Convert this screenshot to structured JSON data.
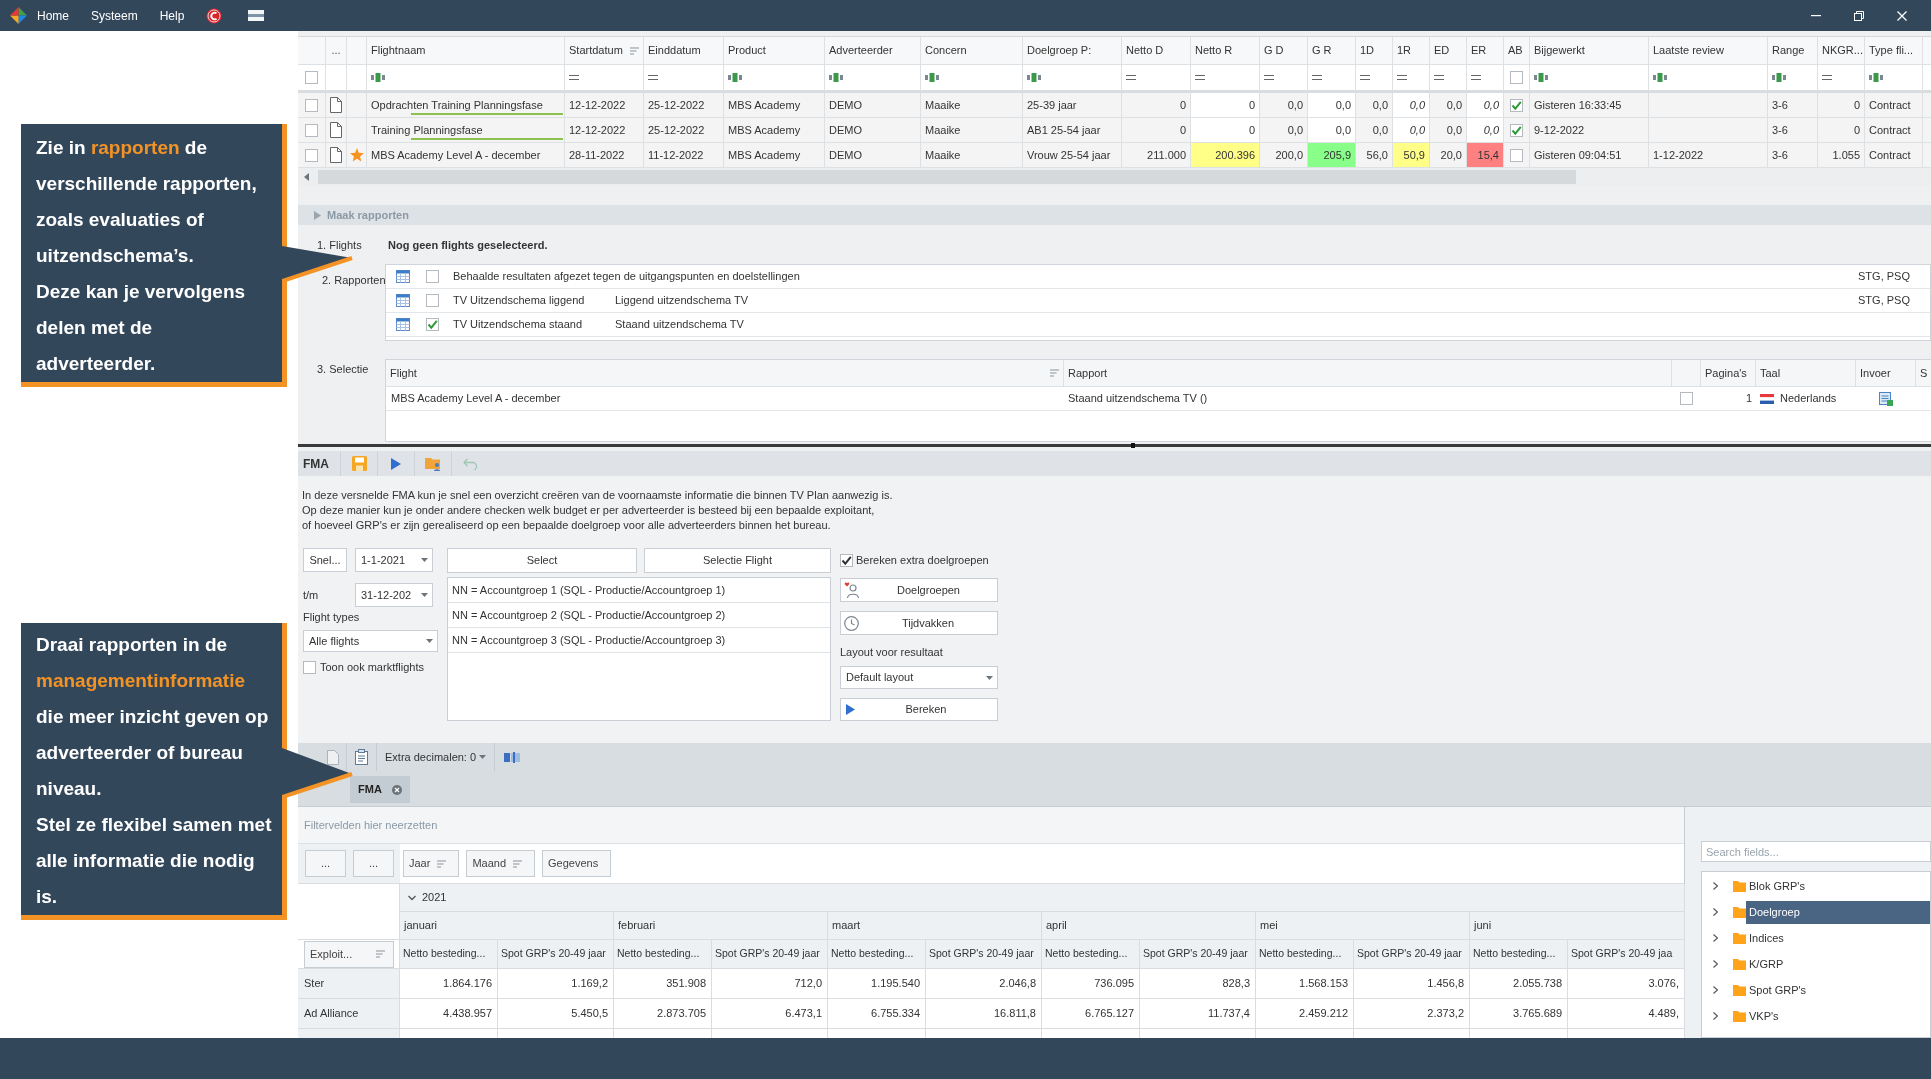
{
  "menu": [
    "Home",
    "Systeem",
    "Help"
  ],
  "callouts": [
    {
      "paragraphs": [
        "Zie in **rapporten** de verschillende rapporten, zoals evaluaties of uitzendschema’s.",
        "Deze kan je vervolgens delen met de adverteerder."
      ]
    },
    {
      "paragraphs": [
        "Draai rapporten in de **managementinformatie** die meer inzicht geven op adverteerder of bureau niveau.",
        "Stel ze flexibel samen met alle informatie die nodig is."
      ]
    }
  ],
  "flights_grid": {
    "menu_header": "...",
    "select_all_checked": false,
    "columns": [
      {
        "label": "Flightnaam",
        "kind": "text",
        "sorted": false
      },
      {
        "label": "Startdatum",
        "kind": "date",
        "sorted": true
      },
      {
        "label": "Einddatum",
        "kind": "date",
        "sorted": false
      },
      {
        "label": "Product",
        "kind": "text",
        "sorted": false
      },
      {
        "label": "Adverteerder",
        "kind": "text",
        "sorted": false
      },
      {
        "label": "Concern",
        "kind": "text",
        "sorted": false
      },
      {
        "label": "Doelgroep P:",
        "kind": "text",
        "sorted": false
      },
      {
        "label": "Netto D",
        "kind": "number",
        "sorted": false
      },
      {
        "label": "Netto R",
        "kind": "entry",
        "sorted": false
      },
      {
        "label": "G D",
        "kind": "number",
        "sorted": false
      },
      {
        "label": "G R",
        "kind": "entry",
        "sorted": false
      },
      {
        "label": "1D",
        "kind": "number",
        "sorted": false
      },
      {
        "label": "1R",
        "kind": "entry",
        "sorted": false
      },
      {
        "label": "ED",
        "kind": "number",
        "sorted": false
      },
      {
        "label": "ER",
        "kind": "entry",
        "sorted": false
      },
      {
        "label": "AB",
        "kind": "check",
        "sorted": false,
        "filter_checked": false
      },
      {
        "label": "Bijgewerkt",
        "kind": "text",
        "sorted": false
      },
      {
        "label": "Laatste review",
        "kind": "text",
        "sorted": false
      },
      {
        "label": "Range",
        "kind": "text",
        "sorted": false
      },
      {
        "label": "NKGR...",
        "kind": "number",
        "sorted": false
      },
      {
        "label": "Type fli...",
        "kind": "text",
        "sorted": false
      }
    ],
    "rows": [
      {
        "checked": false,
        "starred": false,
        "underlined": true,
        "cells": [
          "Opdrachten Training Planningsfase",
          "12-12-2022",
          "25-12-2022",
          "MBS Academy",
          "DEMO",
          "Maaike",
          "25-39 jaar",
          "0",
          "0",
          "0,0",
          "0,0",
          "0,0",
          {
            "text": "0,0",
            "estimated": true
          },
          "0,0",
          {
            "text": "0,0",
            "estimated": true
          },
          {
            "checked": true
          },
          "Gisteren 16:33:45",
          null,
          "3-6",
          "0",
          "Contract"
        ]
      },
      {
        "checked": false,
        "starred": false,
        "underlined": true,
        "cells": [
          "Training Planningsfase",
          "12-12-2022",
          "25-12-2022",
          "MBS Academy",
          "DEMO",
          "Maaike",
          "AB1 25-54 jaar",
          "0",
          "0",
          "0,0",
          "0,0",
          "0,0",
          {
            "text": "0,0",
            "estimated": true
          },
          "0,0",
          {
            "text": "0,0",
            "estimated": true
          },
          {
            "checked": true
          },
          "9-12-2022",
          null,
          "3-6",
          "0",
          "Contract"
        ]
      },
      {
        "checked": false,
        "starred": true,
        "underlined": false,
        "cells": [
          "MBS Academy Level A - december",
          "28-11-2022",
          "11-12-2022",
          "MBS Academy",
          "DEMO",
          "Maaike",
          "Vrouw 25-54 jaar",
          "211.000",
          {
            "text": "200.396",
            "color": "#ffff88"
          },
          "200,0",
          {
            "text": "205,9",
            "color": "#88ff88"
          },
          "56,0",
          {
            "text": "50,9",
            "color": "#ffff88",
            "estimated": false
          },
          "20,0",
          {
            "text": "15,4",
            "color": "#ff8080",
            "estimated": false
          },
          {
            "checked": false
          },
          "Gisteren 09:04:51",
          "1-12-2022",
          "3-6",
          "1.055",
          "Contract"
        ]
      }
    ]
  },
  "reports_panel": {
    "title": "Maak rapporten",
    "step_flights": "1. Flights",
    "no_flights": "Nog geen flights geselecteerd.",
    "step_reports": "2. Rapporten",
    "reports": [
      {
        "checked": false,
        "name": "Behaalde resultaten afgezet tegen de uitgangspunten en doelstellingen",
        "codes": "STG, PSQ"
      },
      {
        "checked": false,
        "name": "TV Uitzendschema liggend",
        "description": "Liggend uitzendschema TV",
        "codes": "STG, PSQ"
      },
      {
        "checked": true,
        "name": "TV Uitzendschema staand",
        "description": "Staand uitzendschema TV"
      }
    ],
    "step_selection": "3. Selectie",
    "selection": {
      "columns": [
        {
          "label": "Flight",
          "sorted": true
        },
        {
          "label": "Rapport",
          "sorted": false
        },
        {
          "label": "Pagina's",
          "sorted": false
        },
        {
          "label": "Taal",
          "sorted": false
        },
        {
          "label": "Invoer",
          "sorted": false
        },
        {
          "label": "S",
          "sorted": false
        }
      ],
      "rows": [
        {
          "flight": "MBS Academy Level A - december",
          "report": "Staand uitzendschema TV ()",
          "checked": false,
          "pages": "1",
          "language": "Nederlands"
        }
      ]
    }
  },
  "fma": {
    "title": "FMA",
    "undo_disabled": true,
    "description": [
      "In deze versnelde FMA kun je snel een overzicht creëren van de voornaamste informatie die binnen TV Plan aanwezig is.",
      "Op deze manier kun je onder andere checken welk budget er per adverteerder is besteed bij een bepaalde exploitant,",
      "of hoeveel GRP's er zijn gerealiseerd op een bepaalde doelgroep voor alle adverteerders binnen het bureau."
    ],
    "quick_button": "Snel...",
    "date_from": "1-1-2021",
    "to_label": "t/m",
    "date_to": "31-12-202",
    "flight_types_label": "Flight types",
    "flight_type": "Alle flights",
    "market_flights": {
      "label": "Toon ook marktflights",
      "checked": false
    },
    "select_button": "Select",
    "selection_flight_button": "Selectie Flight",
    "account_groups": [
      "NN = Accountgroep 1 (SQL - Productie/Accountgroep 1)",
      "NN = Accountgroep 2 (SQL - Productie/Accountgroep 2)",
      "NN = Accountgroep 3 (SQL - Productie/Accountgroep 3)"
    ],
    "extra_targets": {
      "label": "Bereken extra doelgroepen",
      "checked": true
    },
    "targets_button": "Doelgroepen",
    "periods_button": "Tijdvakken",
    "layout_label": "Layout voor resultaat",
    "layout": "Default layout",
    "compute_button": "Bereken"
  },
  "pivot_toolbar": {
    "export_disabled": true,
    "decimals_label": "Extra decimalen: 0"
  },
  "tabs": [
    {
      "label": "FMA",
      "selected": true
    }
  ],
  "pivot": {
    "filter_hint": "Filtervelden hier neerzetten",
    "data_area_buttons": [
      "...",
      "..."
    ],
    "column_fields": [
      {
        "label": "Jaar",
        "sorted": true
      },
      {
        "label": "Maand",
        "sorted": true
      },
      {
        "label": "Gegevens",
        "sorted": false
      }
    ],
    "row_field": {
      "label": "Exploit...",
      "sorted": true
    },
    "year": {
      "label": "2021",
      "expanded": true
    },
    "months": [
      {
        "label": "januari",
        "measures": [
          "Netto besteding...",
          "Spot GRP's 20-49 jaar"
        ]
      },
      {
        "label": "februari",
        "measures": [
          "Netto besteding...",
          "Spot GRP's 20-49 jaar"
        ]
      },
      {
        "label": "maart",
        "measures": [
          "Netto besteding...",
          "Spot GRP's 20-49 jaar"
        ]
      },
      {
        "label": "april",
        "measures": [
          "Netto besteding...",
          "Spot GRP's 20-49 jaar"
        ]
      },
      {
        "label": "mei",
        "measures": [
          "Netto besteding...",
          "Spot GRP's 20-49 jaar"
        ]
      },
      {
        "label": "juni",
        "measures": [
          "Netto besteding...",
          "Spot GRP's 20-49 jaa"
        ]
      }
    ],
    "rows": [
      {
        "label": "Ster",
        "values": [
          "1.864.176",
          "1.169,2",
          "351.908",
          "712,0",
          "1.195.540",
          "2.046,8",
          "736.095",
          "828,3",
          "1.568.153",
          "1.456,8",
          "2.055.738",
          "3.076,"
        ]
      },
      {
        "label": "Ad Alliance",
        "values": [
          "4.438.957",
          "5.450,5",
          "2.873.705",
          "6.473,1",
          "6.755.334",
          "16.811,8",
          "6.765.127",
          "11.737,4",
          "2.459.212",
          "2.373,2",
          "3.765.689",
          "4.489,"
        ]
      }
    ]
  },
  "field_list": {
    "search_placeholder": "Search fields...",
    "fields": [
      {
        "label": "Blok GRP's",
        "selected": false,
        "expanded": false
      },
      {
        "label": "Doelgroep",
        "selected": true,
        "expanded": false
      },
      {
        "label": "Indices",
        "selected": false,
        "expanded": false
      },
      {
        "label": "K/GRP",
        "selected": false,
        "expanded": false
      },
      {
        "label": "Spot GRP's",
        "selected": false,
        "expanded": false
      },
      {
        "label": "VKP's",
        "selected": false,
        "expanded": false
      }
    ]
  }
}
